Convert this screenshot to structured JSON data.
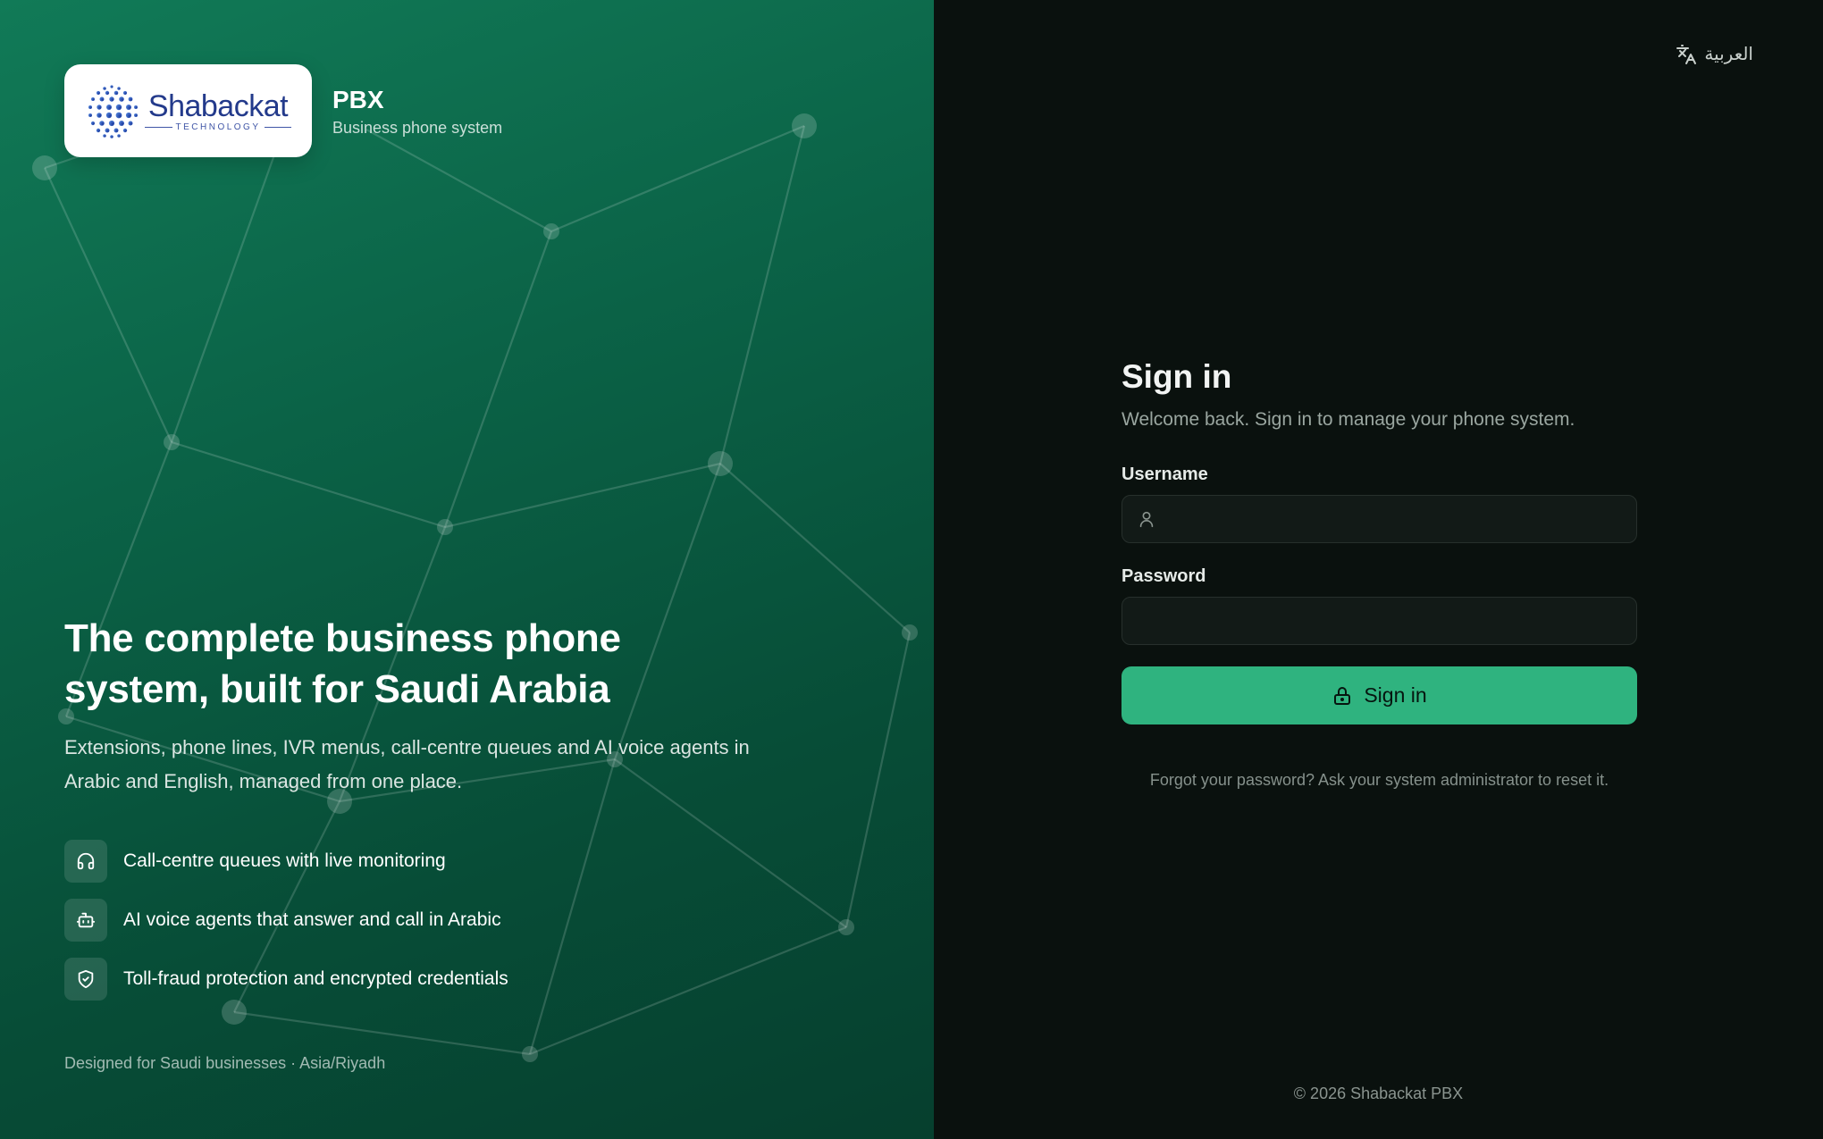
{
  "brand": {
    "logo_word": "Shabackat",
    "logo_sub": "TECHNOLOGY",
    "title": "PBX",
    "subtitle": "Business phone system"
  },
  "hero": {
    "title": "The complete business phone system, built for Saudi Arabia",
    "description": "Extensions, phone lines, IVR menus, call-centre queues and AI voice agents in Arabic and English, managed from one place."
  },
  "features": [
    {
      "icon": "headset-icon",
      "label": "Call-centre queues with live monitoring"
    },
    {
      "icon": "bot-icon",
      "label": "AI voice agents that answer and call in Arabic"
    },
    {
      "icon": "shield-check-icon",
      "label": "Toll-fraud protection and encrypted credentials"
    }
  ],
  "footnote": "Designed for Saudi businesses · Asia/Riyadh",
  "language_toggle": {
    "icon": "translate-icon",
    "label": "العربية"
  },
  "form": {
    "title": "Sign in",
    "subtitle": "Welcome back. Sign in to manage your phone system.",
    "username_label": "Username",
    "username_value": "",
    "password_label": "Password",
    "password_value": "",
    "submit_label": "Sign in",
    "forgot_text": "Forgot your password? Ask your system administrator to reset it."
  },
  "copyright": "© 2026 Shabackat PBX",
  "colors": {
    "left_panel": "#0b6347",
    "right_panel": "#0a110e",
    "accent": "#2fb37f",
    "logo_blue": "#233a8b"
  }
}
